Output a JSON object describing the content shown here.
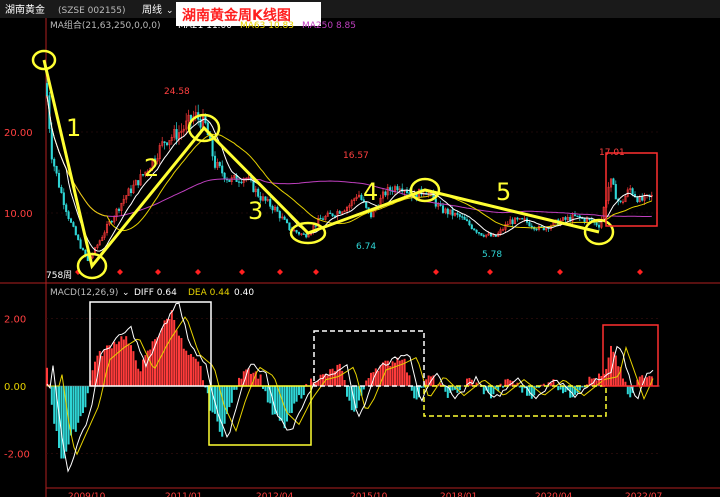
{
  "topbar": {
    "stock_name": "湖南黄金",
    "stock_code": "(SZSE 002155)",
    "period": "周线",
    "caption": "湖南黄金周K线图"
  },
  "ma_legend": {
    "label": "MA组合(21,63,250,0,0,0)",
    "ma21": "MA21 11.00",
    "ma63": "MA63 10.83",
    "ma250": "MA250 8.85"
  },
  "price_axis": {
    "ticks": [
      {
        "label": "20.00",
        "value": 20
      },
      {
        "label": "10.00",
        "value": 10
      }
    ]
  },
  "price_labels": {
    "high1": "24.58",
    "high2": "16.57",
    "high3": "17.01",
    "low1": "6.74",
    "low2": "5.78",
    "low_start": "758周"
  },
  "waves": [
    "1",
    "2",
    "3",
    "4",
    "5"
  ],
  "macd_legend": {
    "label": "MACD(12,26,9)",
    "diff": "DIFF 0.64",
    "dea": "DEA 0.44",
    "macd": "0.40"
  },
  "macd_axis": {
    "ticks": [
      {
        "label": "2.00",
        "value": 2
      },
      {
        "label": "0.00",
        "value": 0
      },
      {
        "label": "-2.00",
        "value": -2
      }
    ]
  },
  "time_axis": [
    "2009/10",
    "2011/01",
    "2012/04",
    "2015/10",
    "2018/01",
    "2020/04",
    "2022/07"
  ],
  "colors": {
    "up": "#ff3b3b",
    "down": "#2fd6d6",
    "ma21": "#ffffff",
    "ma63": "#e6d200",
    "ma250": "#c040c0",
    "annotation": "#ffff33",
    "caption_bg": "#ffffff",
    "caption_fg": "#ff2020"
  }
}
